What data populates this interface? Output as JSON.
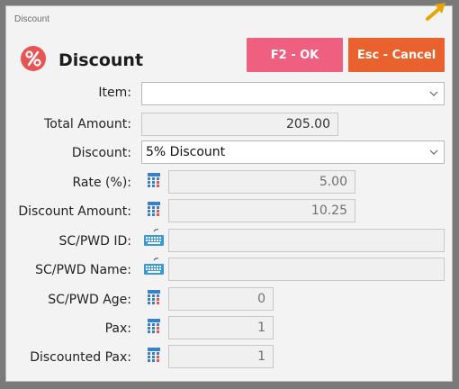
{
  "window": {
    "title": "Discount"
  },
  "header": {
    "title": "Discount",
    "icon": "percent-icon",
    "icon_color": "#e85454"
  },
  "buttons": {
    "ok_label": "F2 - OK",
    "ok_color": "#ef5f7f",
    "cancel_label": "Esc - Cancel",
    "cancel_color": "#e9622e"
  },
  "form": {
    "item": {
      "label": "Item:",
      "value": ""
    },
    "total_amount": {
      "label": "Total Amount:",
      "value": "205.00"
    },
    "discount": {
      "label": "Discount:",
      "value": "5% Discount"
    },
    "rate": {
      "label": "Rate (%):",
      "value": "5.00"
    },
    "discount_amount": {
      "label": "Discount Amount:",
      "value": "10.25"
    },
    "sc_pwd_id": {
      "label": "SC/PWD ID:",
      "value": ""
    },
    "sc_pwd_name": {
      "label": "SC/PWD Name:",
      "value": ""
    },
    "sc_pwd_age": {
      "label": "SC/PWD Age:",
      "value": "0"
    },
    "pax": {
      "label": "Pax:",
      "value": "1"
    },
    "discounted_pax": {
      "label": "Discounted Pax:",
      "value": "1"
    }
  }
}
